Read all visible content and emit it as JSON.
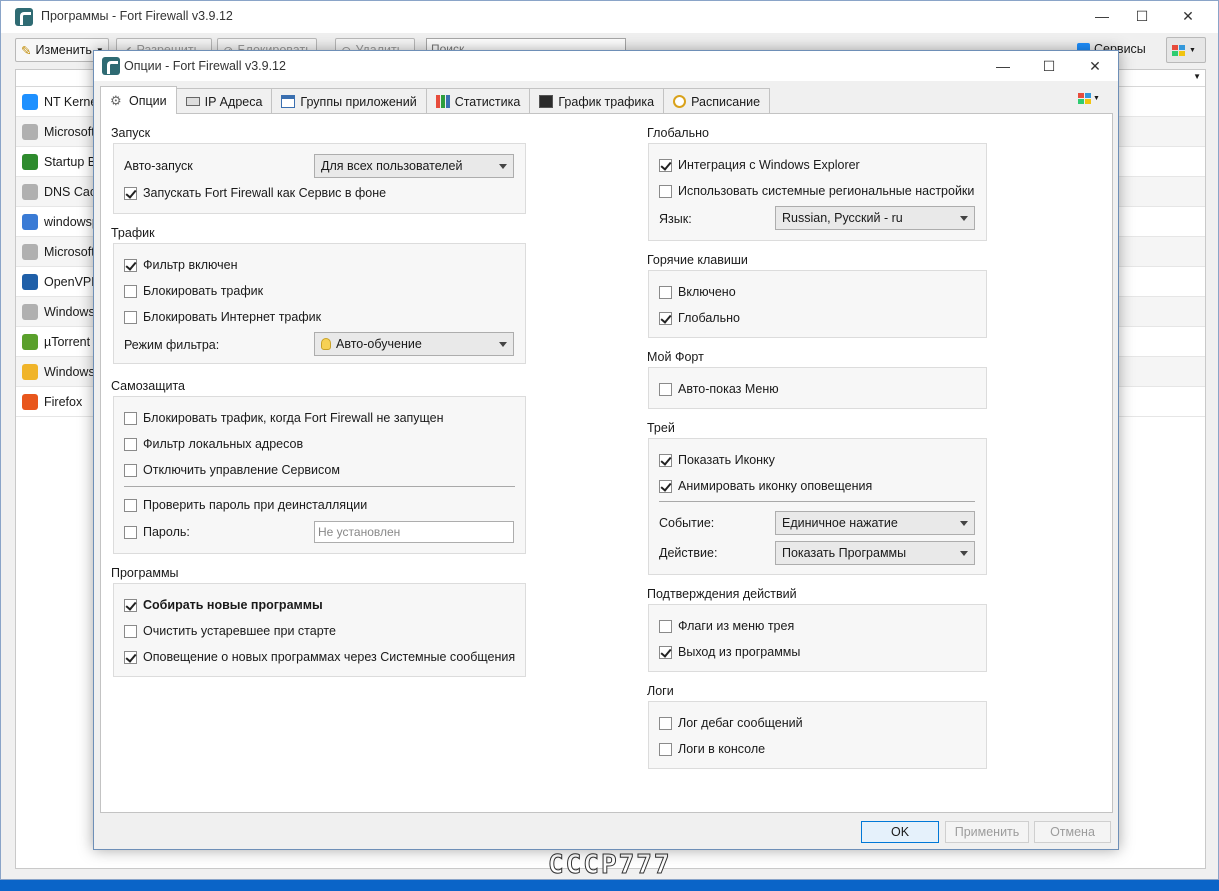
{
  "main_window": {
    "title": "Программы - Fort Firewall v3.9.12",
    "toolbar": {
      "edit_label": "Изменить",
      "allow_label": "Разрешить",
      "block_label": "Блокировать",
      "delete_label": "Удалить",
      "search_placeholder": "Поиск",
      "services_label": "Сервисы"
    },
    "programs": [
      {
        "name": "NT Kernel",
        "icon_color": "#1e90ff"
      },
      {
        "name": "Microsoft",
        "icon_color": "#b0b0b0"
      },
      {
        "name": "Startup B",
        "icon_color": "#2e8b2e"
      },
      {
        "name": "DNS Cach",
        "icon_color": "#b0b0b0"
      },
      {
        "name": "windowsp",
        "icon_color": "#3a7bd5"
      },
      {
        "name": "Microsoft",
        "icon_color": "#b0b0b0"
      },
      {
        "name": "OpenVPN",
        "icon_color": "#1f5fa8"
      },
      {
        "name": "Windows",
        "icon_color": "#b0b0b0"
      },
      {
        "name": "µTorrent",
        "icon_color": "#5aa02c"
      },
      {
        "name": "Windows",
        "icon_color": "#f0b429"
      },
      {
        "name": "Firefox",
        "icon_color": "#e8561c"
      }
    ]
  },
  "dialog": {
    "title": "Опции - Fort Firewall v3.9.12",
    "tabs": [
      {
        "label": "Опции",
        "icon": "gear-icon",
        "active": true
      },
      {
        "label": "IP Адреса",
        "icon": "network-card-icon"
      },
      {
        "label": "Группы приложений",
        "icon": "app-groups-icon"
      },
      {
        "label": "Статистика",
        "icon": "bar-chart-icon"
      },
      {
        "label": "График трафика",
        "icon": "traffic-graph-icon"
      },
      {
        "label": "Расписание",
        "icon": "clock-icon"
      }
    ],
    "startup": {
      "title": "Запуск",
      "autorun_label": "Авто-запуск",
      "autorun_value": "Для всех пользователей",
      "service_label": "Запускать Fort Firewall как Сервис в фоне",
      "service_checked": true
    },
    "traffic": {
      "title": "Трафик",
      "filter_enabled": "Фильтр включен",
      "block_traffic": "Блокировать трафик",
      "block_inet": "Блокировать Интернет трафик",
      "filter_mode_label": "Режим фильтра:",
      "filter_mode_value": "Авто-обучение"
    },
    "protection": {
      "title": "Самозащита",
      "block_when_off": "Блокировать трафик, когда Fort Firewall не запущен",
      "filter_local": "Фильтр локальных адресов",
      "disable_service_ctrl": "Отключить управление Сервисом",
      "check_pwd_uninstall": "Проверить пароль при деинсталляции",
      "password_label": "Пароль:",
      "password_placeholder": "Не установлен"
    },
    "programs": {
      "title": "Программы",
      "collect_new": "Собирать новые программы",
      "purge_obsolete": "Очистить устаревшее при старте",
      "notify_new": "Оповещение о новых программах через Системные сообщения"
    },
    "global": {
      "title": "Глобально",
      "explorer_integration": "Интеграция с Windows Explorer",
      "system_locale": "Использовать системные региональные настройки",
      "language_label": "Язык:",
      "language_value": "Russian, Русский - ru"
    },
    "hotkeys": {
      "title": "Горячие клавиши",
      "enabled": "Включено",
      "global": "Глобально"
    },
    "myfort": {
      "title": "Мой Форт",
      "auto_show_menu": "Авто-показ Меню"
    },
    "tray": {
      "title": "Трей",
      "show_icon": "Показать Иконку",
      "animate_icon": "Анимировать иконку оповещения",
      "event_label": "Событие:",
      "event_value": "Единичное нажатие",
      "action_label": "Действие:",
      "action_value": "Показать Программы"
    },
    "confirm": {
      "title": "Подтверждения действий",
      "tray_flags": "Флаги из меню трея",
      "exit_program": "Выход из программы"
    },
    "logs": {
      "title": "Логи",
      "debug_log": "Лог дебаг сообщений",
      "console_log": "Логи в консоле"
    },
    "buttons": {
      "ok": "OK",
      "apply": "Применить",
      "cancel": "Отмена"
    }
  },
  "watermark": "CCCP777"
}
